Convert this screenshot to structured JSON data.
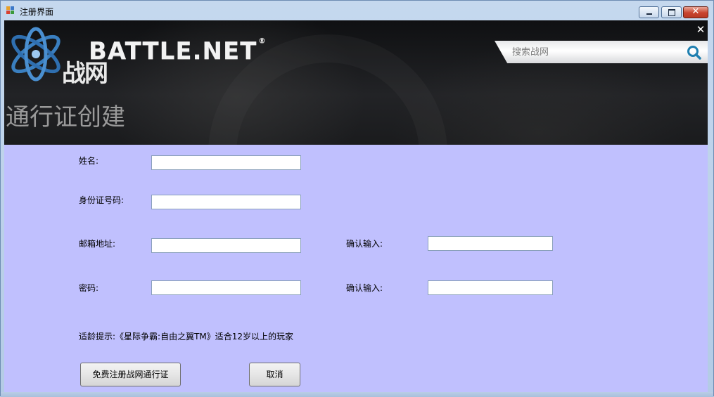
{
  "window": {
    "title": "注册界面",
    "close_glyph": "✕"
  },
  "banner": {
    "brand": "BATTLE.NET",
    "brand_tm": "®",
    "logo_cn": "战网",
    "close_glyph": "✕",
    "search_placeholder": "搜索战网",
    "heading": "通行证创建"
  },
  "form": {
    "name_label": "姓名:",
    "id_label": "身份证号码:",
    "email_label": "邮箱地址:",
    "email_confirm_label": "确认输入:",
    "password_label": "密码:",
    "password_confirm_label": "确认输入:",
    "name_value": "",
    "id_value": "",
    "email_value": "",
    "email_confirm_value": "",
    "password_value": "",
    "password_confirm_value": "",
    "age_note": "适龄提示:《星际争霸:自由之翼TM》适合12岁以上的玩家",
    "register_button": "免费注册战网通行证",
    "cancel_button": "取消"
  },
  "icons": {
    "app": "app-window-icon",
    "search": "search-icon",
    "logo": "battlenet-logo-icon"
  },
  "colors": {
    "form_background": "#c0c0fe",
    "search_accent": "#1e7fb0",
    "logo_blue": "#3a7fc0"
  }
}
